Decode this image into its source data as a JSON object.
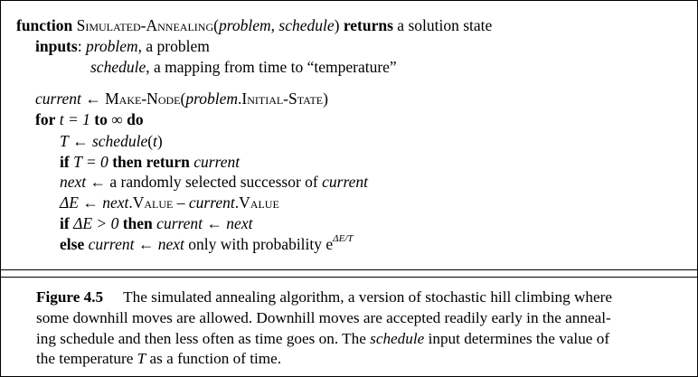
{
  "algorithm": {
    "header": {
      "kw_function": "function",
      "name": "Simulated-Annealing",
      "open": "(",
      "arg1": "problem",
      "comma": ", ",
      "arg2": "schedule",
      "close": ")",
      "kw_returns": "returns",
      "rest": "a solution state"
    },
    "inputs": {
      "kw_inputs": "inputs",
      "colon": ":",
      "p1_name": "problem",
      "p1_desc": ", a problem",
      "p2_name": "schedule",
      "p2_desc": ", a mapping from time to “temperature”"
    },
    "l_init": {
      "var": "current",
      "arrow": " ← ",
      "fn": "Make-Node",
      "open": "(",
      "obj": "problem",
      "dot": ".",
      "field": "Initial-State",
      "close": ")"
    },
    "l_for": {
      "kw_for": "for",
      "mid": " t = 1 ",
      "kw_to": "to",
      "inf": " ∞ ",
      "kw_do": "do"
    },
    "l_T": {
      "var": "T",
      "arrow": " ← ",
      "fn": "schedule",
      "open": "(",
      "arg": "t",
      "close": ")"
    },
    "l_if0": {
      "kw_if": "if",
      "cond": " T = 0 ",
      "kw_then_return": "then return",
      "var": "current"
    },
    "l_next": {
      "var": "next",
      "arrow": " ← ",
      "text": "a randomly selected successor of ",
      "var2": "current"
    },
    "l_dE": {
      "lhs": "ΔE",
      "arrow": " ← ",
      "a": "next",
      "dot1": ".",
      "f1": "Value",
      "minus": " – ",
      "b": "current",
      "dot2": ".",
      "f2": "Value"
    },
    "l_ifdE": {
      "kw_if": "if",
      "cond": " ΔE > 0 ",
      "kw_then": "then",
      "var1": "current",
      "arrow": " ← ",
      "var2": "next"
    },
    "l_else": {
      "kw_else": "else",
      "var1": "current",
      "arrow": " ← ",
      "var2": "next",
      "text": " only with probability e",
      "sup": "ΔE/T"
    }
  },
  "caption": {
    "label": "Figure 4.5",
    "l1": "The simulated annealing algorithm, a version of stochastic hill climbing where",
    "l2": "some downhill moves are allowed. Downhill moves are accepted readily early in the anneal-",
    "l3a": "ing schedule and then less often as time goes on. The ",
    "l3b": "schedule",
    "l3c": " input determines the value of",
    "l4a": "the temperature ",
    "l4b": "T",
    "l4c": " as a function of time."
  }
}
